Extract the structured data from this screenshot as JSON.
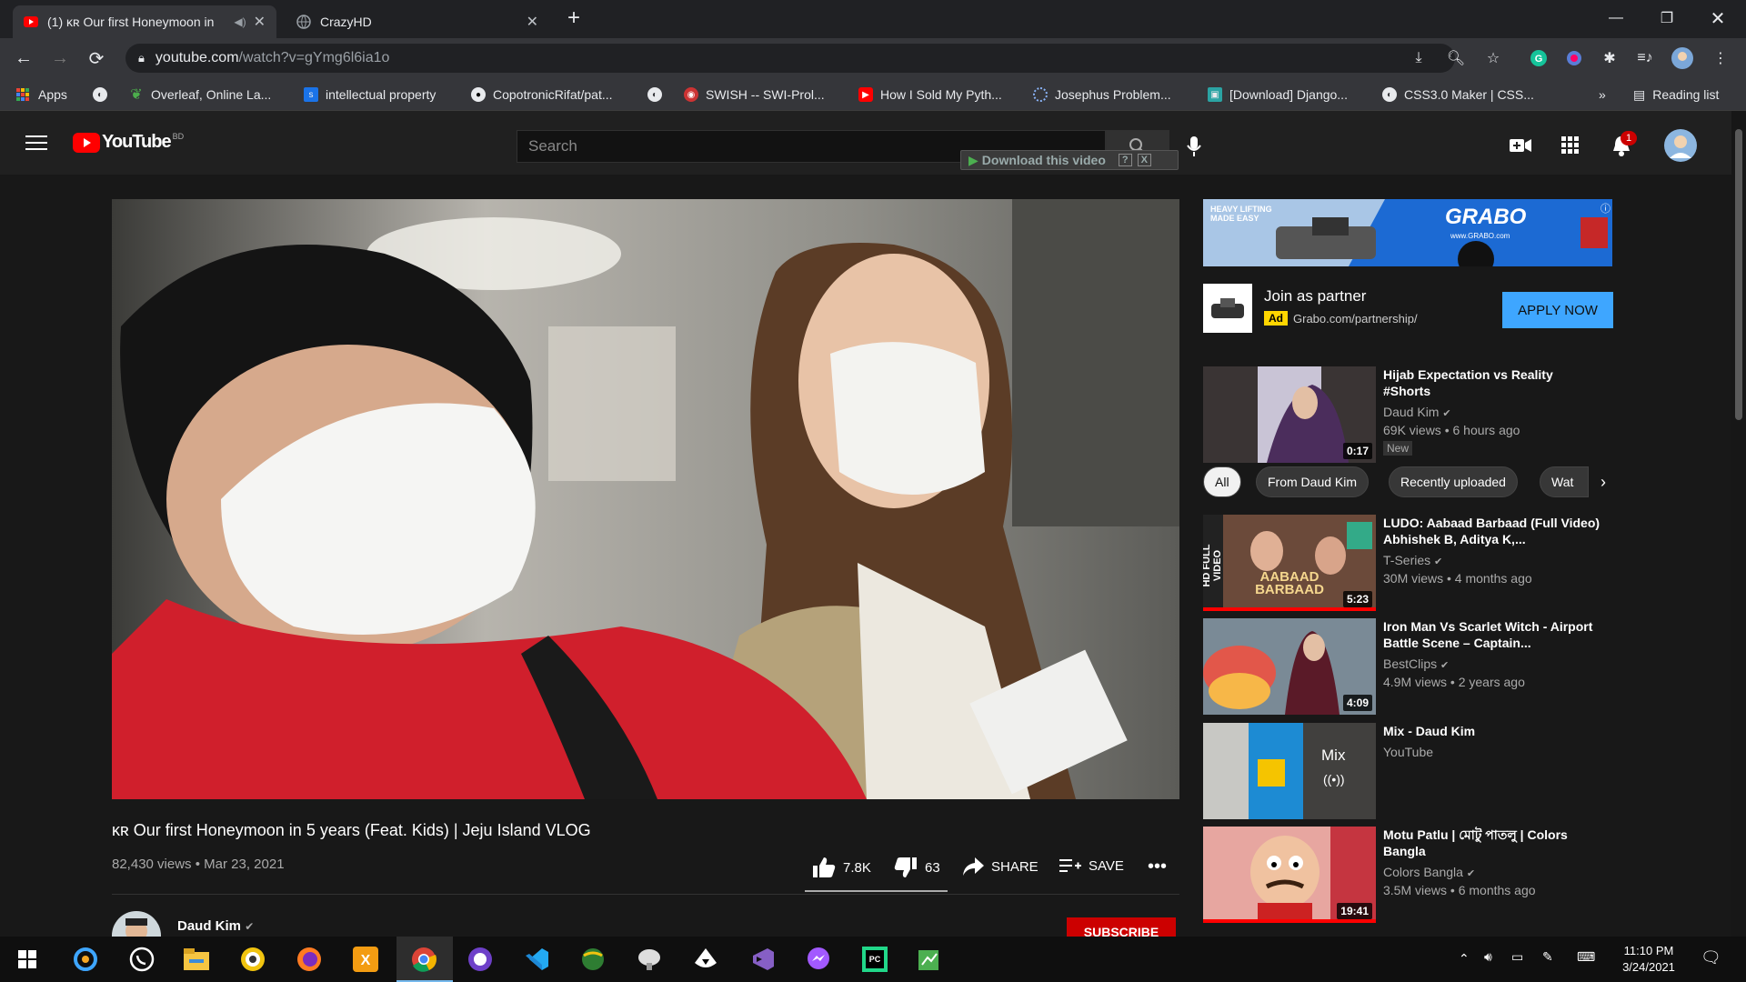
{
  "browser": {
    "tabs": [
      {
        "title": "(1) ᴋʀ Our first Honeymoon in",
        "close": "✕"
      },
      {
        "title": "CrazyHD",
        "close": "✕"
      }
    ],
    "new_tab": "+",
    "url_host": "youtube.com",
    "url_path": "/watch?v=gYmg6l6ia1o",
    "bookmarks": [
      {
        "label": "Apps"
      },
      {
        "label": "Overleaf, Online La..."
      },
      {
        "label": "intellectual property"
      },
      {
        "label": "CopotronicRifat/pat..."
      },
      {
        "label": "SWISH -- SWI-Prol..."
      },
      {
        "label": "How I Sold My Pyth..."
      },
      {
        "label": "Josephus Problem..."
      },
      {
        "label": "[Download] Django..."
      },
      {
        "label": "CSS3.0 Maker | CSS..."
      }
    ],
    "more_bookmarks": "»",
    "reading_list": "Reading list"
  },
  "youtube": {
    "logo_text": "YouTube",
    "logo_country": "BD",
    "search_placeholder": "Search",
    "download_overlay": "Download this video",
    "download_overlay_extra": "?",
    "notifications_count": "1"
  },
  "ad": {
    "banner_brand": "GRABO",
    "banner_site": "www.GRABO.com",
    "banner_tagline": "HEAVY LIFTING MADE EASY",
    "title": "Join as partner",
    "badge": "Ad",
    "url": "Grabo.com/partnership/",
    "cta": "APPLY NOW"
  },
  "video": {
    "title": "ᴋʀ Our first Honeymoon in 5 years (Feat. Kids) | Jeju Island VLOG",
    "views": "82,430 views",
    "date": "Mar 23, 2021",
    "likes": "7.8K",
    "dislikes": "63",
    "share": "SHARE",
    "save": "SAVE",
    "channel": "Daud Kim",
    "subscribe": "SUBSCRIBE"
  },
  "chips": [
    "All",
    "From Daud Kim",
    "Recently uploaded",
    "Wat"
  ],
  "related": [
    {
      "title": "Hijab Expectation vs Reality #Shorts",
      "channel": "Daud Kim",
      "meta": "69K views • 6 hours ago",
      "badge": "New",
      "duration": "0:17"
    },
    {
      "title": "LUDO: Aabaad Barbaad (Full Video) Abhishek B, Aditya K,...",
      "channel": "T-Series",
      "meta": "30M views • 4 months ago",
      "duration": "5:23",
      "thumb_text": "AABAAD BARBAAD",
      "thumb_side": "HD FULL VIDEO"
    },
    {
      "title": "Iron Man Vs Scarlet Witch - Airport Battle Scene – Captain...",
      "channel": "BestClips",
      "meta": "4.9M views • 2 years ago",
      "duration": "4:09"
    },
    {
      "title": "Mix - Daud Kim",
      "channel": "YouTube",
      "mix_label": "Mix"
    },
    {
      "title": "Motu Patlu | মোটু পাতলু | Colors Bangla",
      "channel": "Colors Bangla",
      "meta": "3.5M views • 6 months ago",
      "duration": "19:41"
    }
  ],
  "taskbar": {
    "time": "11:10 PM",
    "date": "3/24/2021"
  },
  "colors": {
    "yt_red": "#ff0000",
    "apply_blue": "#3ea6ff",
    "ad_yellow": "#ffd600",
    "subscribe_red": "#cc0000"
  }
}
